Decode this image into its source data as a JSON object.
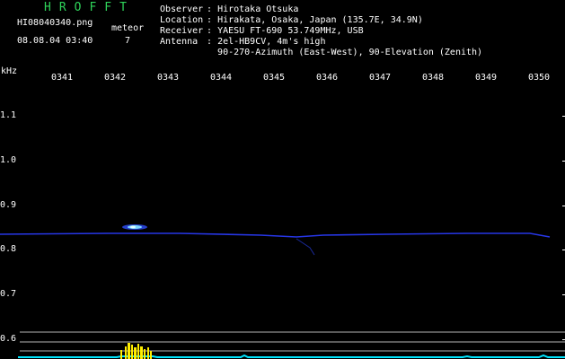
{
  "header": {
    "title": "HROFFT",
    "filename": "HI08040340.png",
    "datetime": "08.08.04 03:40",
    "meteor_label": "meteor",
    "meteor_count": "7"
  },
  "info": [
    {
      "key": "Observer",
      "sep": ":",
      "value": "Hirotaka Otsuka"
    },
    {
      "key": "Location",
      "sep": ":",
      "value": "Hirakata, Osaka, Japan (135.7E, 34.9N)"
    },
    {
      "key": "Receiver",
      "sep": ":",
      "value": "YAESU FT-690 53.749MHz, USB"
    },
    {
      "key": "Antenna",
      "sep": ":",
      "value": "2el-HB9CV, 4m's high"
    },
    {
      "key": "",
      "sep": "",
      "value": "90-270-Azimuth (East-West), 90-Elevation (Zenith)"
    }
  ],
  "y_axis": {
    "unit": "kHz",
    "labels": [
      "1.1",
      "1.0",
      "0.9",
      "0.8",
      "0.7",
      "0.6"
    ]
  },
  "time_axis": [
    "0341",
    "0342",
    "0343",
    "0344",
    "0345",
    "0346",
    "0347",
    "0348",
    "0349",
    "0350"
  ],
  "colors": {
    "title": "#2fd35a",
    "carrier": "#2a3cff",
    "echo": "#7dd8ff",
    "cyan_trace": "#00e5ff",
    "yellow_burst": "#ffee00",
    "guide_lines": "#b4b4b4"
  }
}
